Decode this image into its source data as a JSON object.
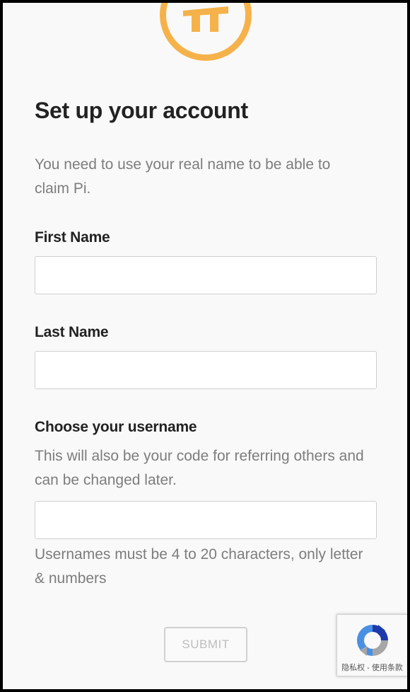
{
  "header": {
    "logo_icon": "pi-logo-icon",
    "title": "Set up your account",
    "intro": "You need to use your real name to be able to claim Pi."
  },
  "form": {
    "first_name_label": "First Name",
    "first_name_value": "",
    "last_name_label": "Last Name",
    "last_name_value": "",
    "username_label": "Choose your username",
    "username_help": "This will also be your code for referring others and can be changed later.",
    "username_value": "",
    "username_rules": "Usernames must be 4 to 20 characters, only letter & numbers",
    "submit_label": "SUBMIT"
  },
  "recaptcha": {
    "icon": "recaptcha-icon",
    "links": "隐私权 - 使用条款"
  },
  "colors": {
    "accent": "#f6b24a",
    "background": "#f9f9f9",
    "text": "#222222",
    "muted": "#7d7d7d"
  }
}
